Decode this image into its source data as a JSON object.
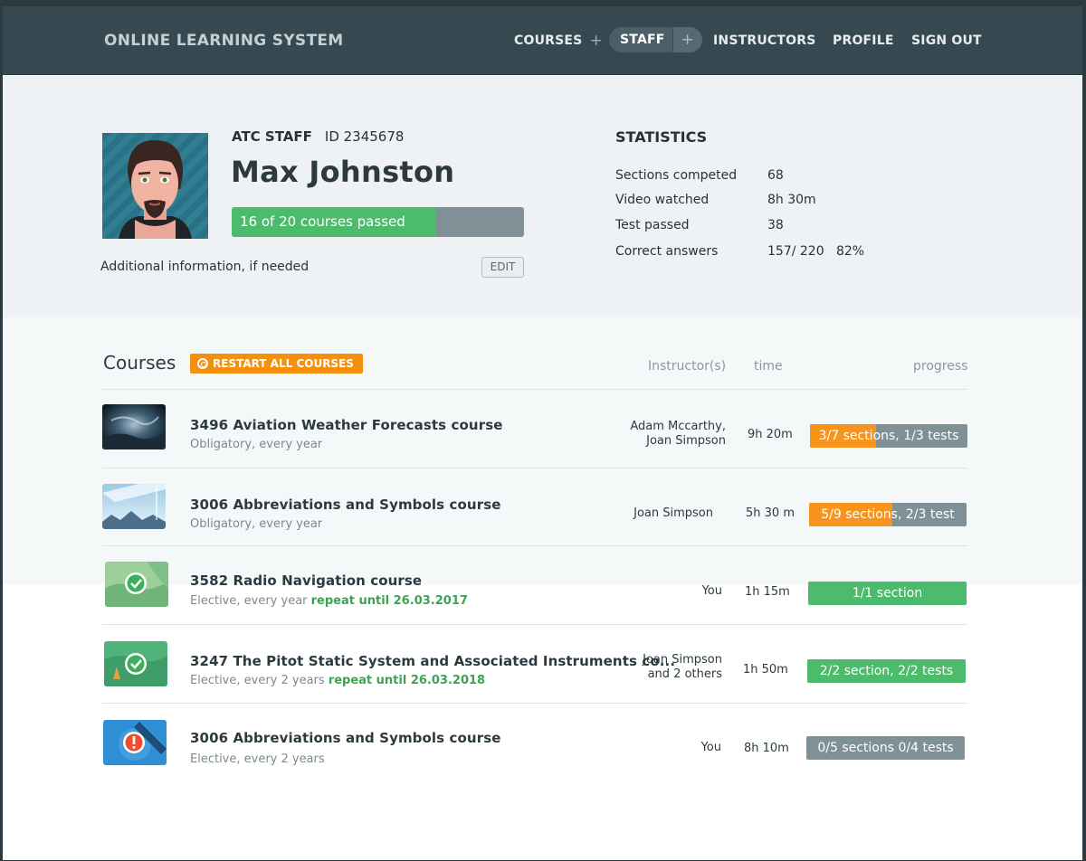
{
  "header": {
    "brand": "ONLINE LEARNING SYSTEM",
    "nav": {
      "courses": "COURSES",
      "staff": "STAFF",
      "instructors": "INSTRUCTORS",
      "profile": "PROFILE",
      "signout": "SIGN OUT",
      "plus": "+"
    }
  },
  "profile": {
    "role": "ATC STAFF",
    "id": "ID 2345678",
    "name": "Max Johnston",
    "progress_text": "16 of 20 courses passed",
    "progress_fraction": 0.7,
    "additional_info": "Additional information, if needed",
    "edit_label": "EDIT"
  },
  "statistics": {
    "title": "STATISTICS",
    "items": [
      {
        "label": "Sections competed",
        "value": "68"
      },
      {
        "label": "Video watched",
        "value": "8h 30m"
      },
      {
        "label": "Test passed",
        "value": "38"
      },
      {
        "label": "Correct answers",
        "value": "157/ 220   82%"
      }
    ]
  },
  "courses": {
    "title": "Courses",
    "restart_label": "RESTART ALL COURSES",
    "columns": {
      "instructors": "Instructor(s)",
      "time": "time",
      "progress": "progress"
    },
    "rows": [
      {
        "title": "3496 Aviation Weather Forecasts course",
        "subtitle": "Obligatory, every year",
        "repeat": "",
        "instructor_lines": [
          "Adam Mccarthy,",
          "Joan Simpson"
        ],
        "time": "9h 20m",
        "progress_text": "3/7 sections, 1/3 tests",
        "progress_fraction": 0.42,
        "progress_color": "#f7941d",
        "thumb": "storm-clouds-image"
      },
      {
        "title": "3006 Abbreviations and Symbols course",
        "subtitle": "Obligatory, every year",
        "repeat": "",
        "instructor_lines": [
          "Joan Simpson"
        ],
        "time": "5h 30 m",
        "progress_text": "5/9 sections, 2/3 test",
        "progress_fraction": 0.53,
        "progress_color": "#f7941d",
        "thumb": "mountain-sky-image"
      },
      {
        "title": "3582 Radio Navigation course",
        "subtitle": "Elective, every year ",
        "repeat": "repeat until 26.03.2017",
        "instructor_lines": [
          "You"
        ],
        "time": "1h 15m",
        "progress_text": "1/1 section",
        "progress_fraction": 1.0,
        "progress_color": "#4dbb6c",
        "thumb": "completed-check-image"
      },
      {
        "title": "3247 The Pitot Static System and Associated Instruments  co...",
        "subtitle": "Elective, every 2 years ",
        "repeat": "repeat until 26.03.2018",
        "instructor_lines": [
          "Joan Simpson",
          "and 2 others"
        ],
        "time": "1h 50m",
        "progress_text": "2/2 section, 2/2 tests",
        "progress_fraction": 1.0,
        "progress_color": "#4dbb6c",
        "thumb": "completed-check-image"
      },
      {
        "title": "3006 Abbreviations and Symbols course",
        "subtitle": "Elective, every 2 years",
        "repeat": "",
        "instructor_lines": [
          "You"
        ],
        "time": "8h 10m",
        "progress_text": "0/5 sections 0/4 tests",
        "progress_fraction": 0.0,
        "progress_color": "#7f9097",
        "thumb": "warning-satellite-image"
      }
    ]
  }
}
